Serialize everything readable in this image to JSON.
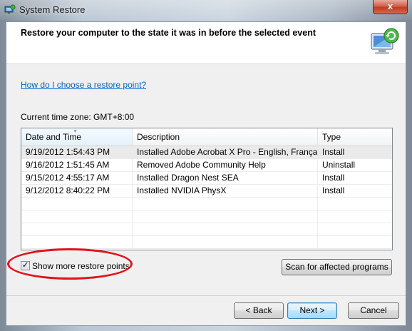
{
  "window": {
    "title": "System Restore",
    "close_glyph": "x"
  },
  "header": {
    "heading": "Restore your computer to the state it was in before the selected event",
    "icon": "system-restore-icon"
  },
  "help_link": "How do I choose a restore point?",
  "timezone_text": "Current time zone: GMT+8:00",
  "table": {
    "columns": [
      "Date and Time",
      "Description",
      "Type"
    ],
    "sorted_column": "Date and Time",
    "rows": [
      {
        "date": "9/19/2012 1:54:43 PM",
        "description": "Installed Adobe Acrobat X Pro - English, Français...",
        "type": "Install"
      },
      {
        "date": "9/16/2012 1:51:45 AM",
        "description": "Removed Adobe Community Help",
        "type": "Uninstall"
      },
      {
        "date": "9/15/2012 4:55:17 AM",
        "description": "Installed Dragon Nest SEA",
        "type": "Install"
      },
      {
        "date": "9/12/2012 8:40:22 PM",
        "description": "Installed NVIDIA PhysX",
        "type": "Install"
      }
    ],
    "selected_row": 0
  },
  "show_more": {
    "label": "Show more restore points",
    "checked": true
  },
  "buttons": {
    "scan": "Scan for affected programs",
    "back": "< Back",
    "next": "Next >",
    "cancel": "Cancel"
  },
  "colors": {
    "link": "#0066cc",
    "highlight_ellipse": "#e0141c",
    "close_button": "#c13b22"
  }
}
